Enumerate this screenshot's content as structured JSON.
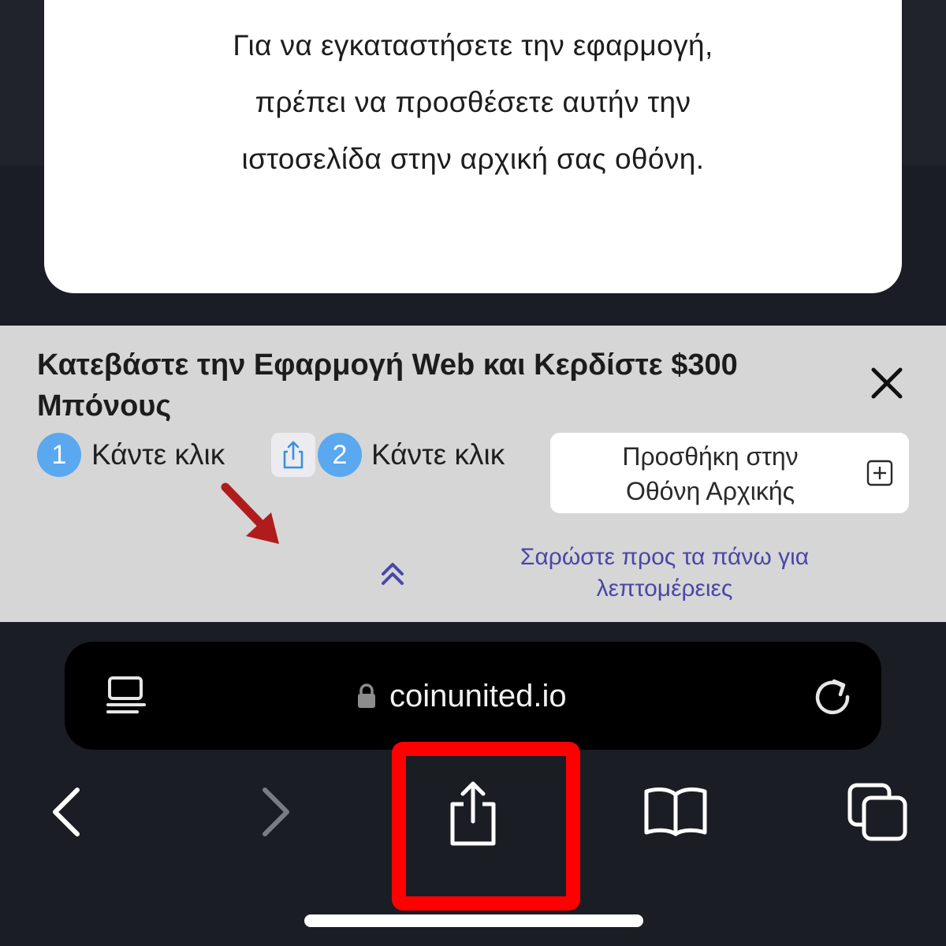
{
  "modal": {
    "message": "Για να εγκαταστήσετε την εφαρμογή,\nπρέπει να προσθέσετε αυτήν την\nιστοσελίδα στην αρχική σας οθόνη."
  },
  "banner": {
    "title": "Κατεβάστε την Εφαρμογή Web και Κερδίστε $300 Μπόνους",
    "step1_number": "1",
    "step1_text": "Κάντε κλικ",
    "step2_number": "2",
    "step2_text": "Κάντε κλικ",
    "add_to_home_label": "Προσθήκη στην\nΟθόνη Αρχικής",
    "swipe_hint": "Σαρώστε προς τα πάνω για\nλεπτομέρειες"
  },
  "browser": {
    "url": "coinunited.io"
  },
  "icons": {
    "close": "close-icon",
    "share_mini": "share-icon",
    "add_square": "plus-square-icon",
    "red_arrow": "arrow-down-right-icon",
    "double_chevron": "double-chevron-up-icon",
    "reader": "reader-mode-icon",
    "lock": "lock-icon",
    "reload": "reload-icon",
    "back": "chevron-left-icon",
    "forward": "chevron-right-icon",
    "share": "share-icon",
    "bookmarks": "book-icon",
    "tabs": "tabs-icon"
  },
  "colors": {
    "highlight": "#ff0000",
    "step_circle": "#5aa8ef",
    "hint_text": "#4a46a8",
    "arrow": "#b01c1c"
  }
}
